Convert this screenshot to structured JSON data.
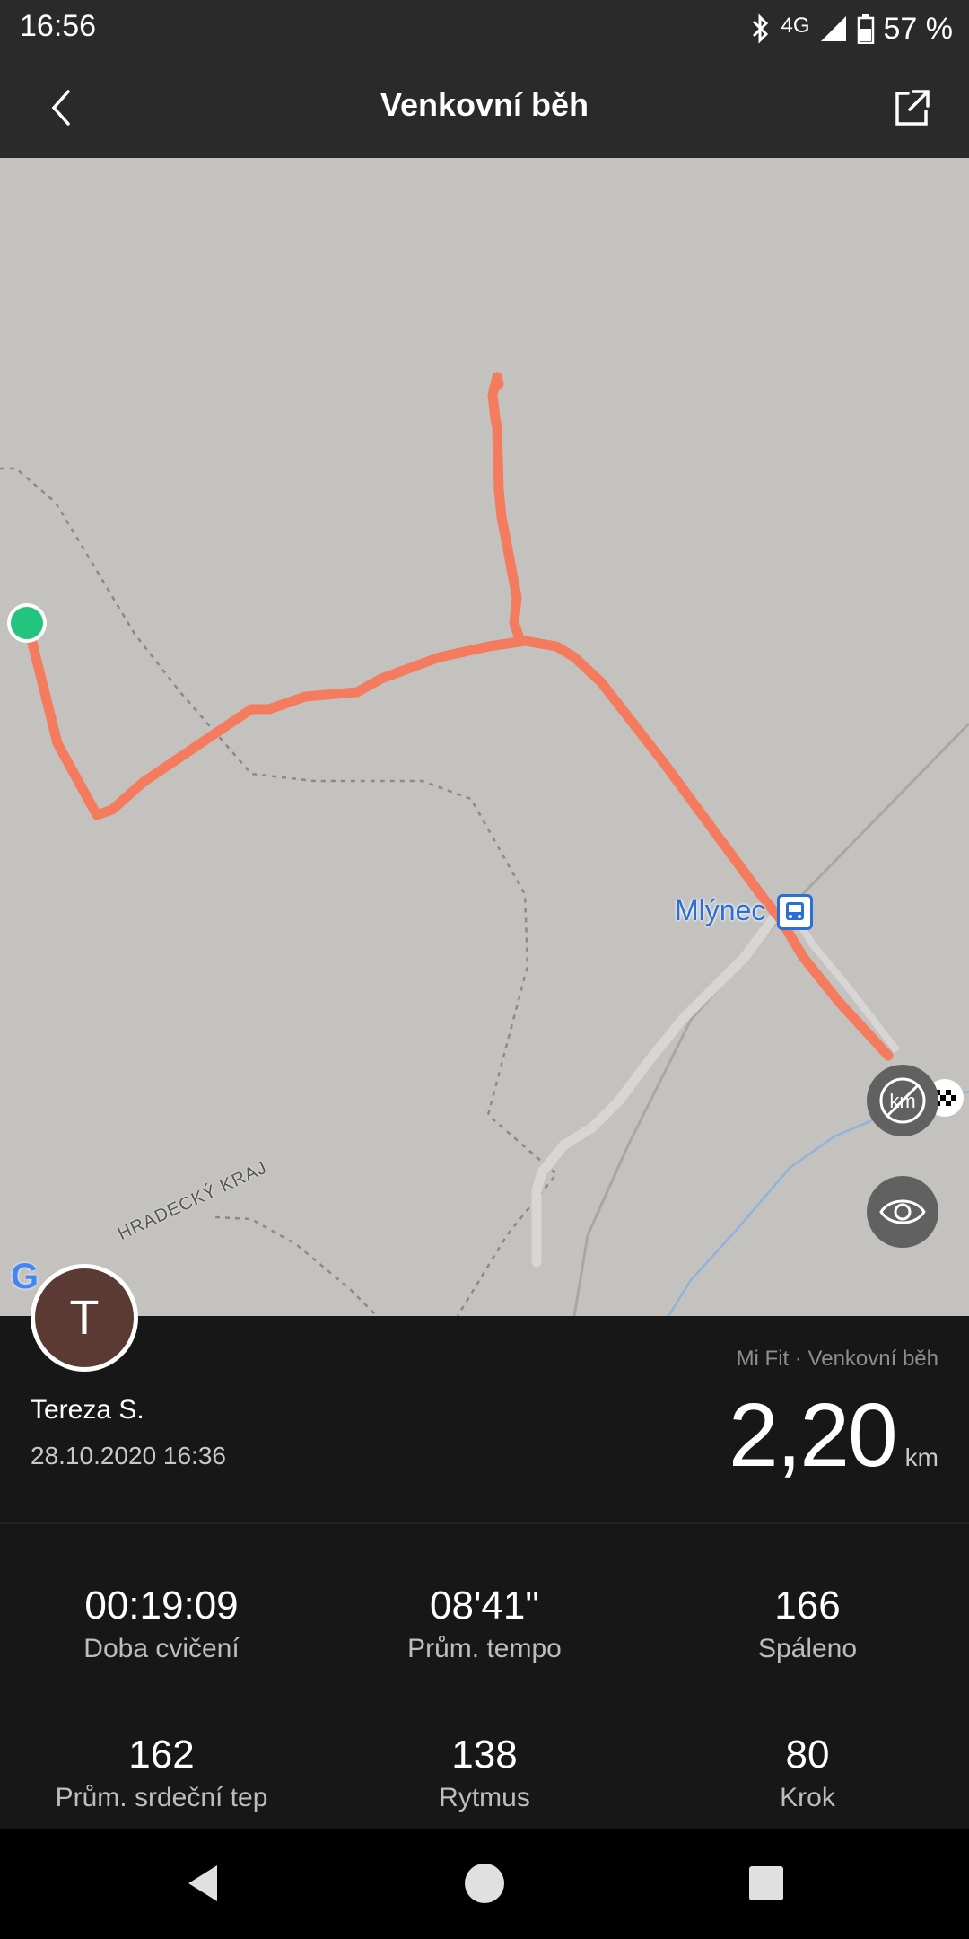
{
  "status_bar": {
    "time": "16:56",
    "network": "4G",
    "battery": "57 %",
    "icons": [
      "bluetooth-icon",
      "signal-icon",
      "battery-icon"
    ]
  },
  "app_bar": {
    "title": "Venkovní běh",
    "back_icon": "back-arrow-icon",
    "share_icon": "share-icon"
  },
  "map": {
    "place_label": "Mlýnec",
    "region_label": "HRADECKÝ KRAJ",
    "logo_text": "G",
    "route_color": "#f47b5e",
    "start_marker_color": "#22c47e",
    "background_color": "#c4c2bf"
  },
  "user": {
    "avatar_letter": "T",
    "name": "Tereza S.",
    "datetime": "28.10.2020 16:36"
  },
  "summary": {
    "source": "Mi Fit · Venkovní běh",
    "distance_value": "2,20",
    "distance_unit": "km"
  },
  "stats": [
    {
      "value": "00:19:09",
      "label": "Doba cvičení"
    },
    {
      "value": "08'41\"",
      "label": "Prům. tempo"
    },
    {
      "value": "166",
      "label": "Spáleno"
    },
    {
      "value": "162",
      "label": "Prům. srdeční tep"
    },
    {
      "value": "138",
      "label": "Rytmus"
    },
    {
      "value": "80",
      "label": "Krok"
    }
  ]
}
